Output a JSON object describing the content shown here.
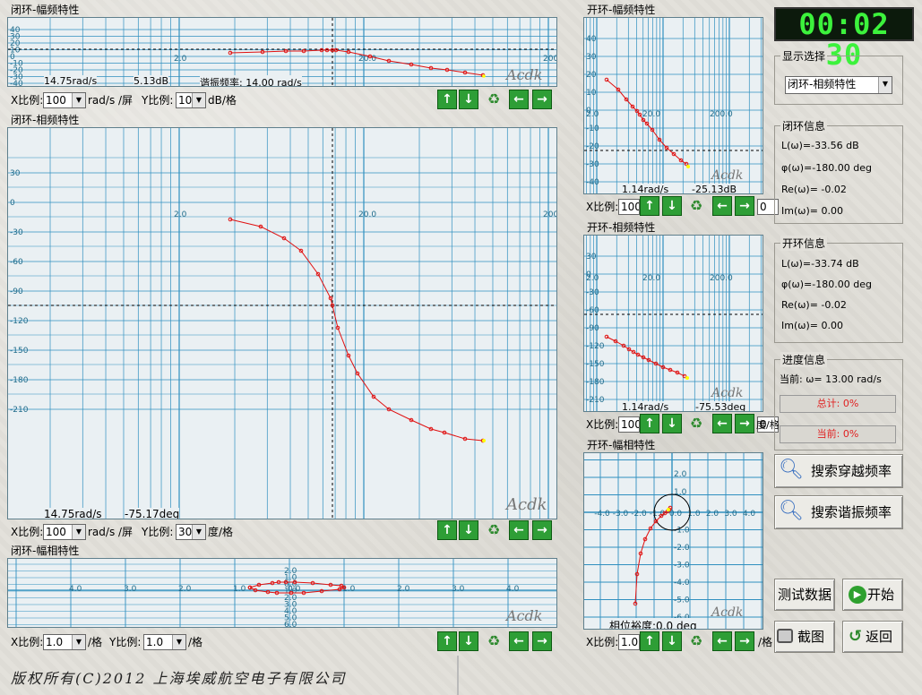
{
  "clock": "00:02 30",
  "brand": "Acdk",
  "footer": "版权所有(C)2012 上海埃威航空电子有限公司",
  "scale": {
    "x_label": "X比例:",
    "y_label": "Y比例:",
    "rad_screen": "rad/s /屏",
    "db_div": "dB/格",
    "deg_div": "度/格",
    "div": "/格",
    "x100": "100",
    "y10": "10",
    "y30": "30",
    "x1": "1.0",
    "y1": "1.0",
    "y0": "0"
  },
  "p1": {
    "title": "闭环-幅频特性",
    "yticks": [
      "40",
      "30",
      "20",
      "10",
      "0",
      "-10",
      "-20",
      "-30",
      "-40"
    ],
    "xticks": [
      "2.0",
      "20.0",
      "200"
    ],
    "readout_w": "14.75rad/s",
    "readout_v": "5.13dB",
    "resonance": "谐振频率: 14.00 rad/s"
  },
  "p2": {
    "title": "闭环-相频特性",
    "yticks": [
      "30",
      "0",
      "-30",
      "-60",
      "-90",
      "-120",
      "-150",
      "-180",
      "-210"
    ],
    "xticks": [
      "2.0",
      "20.0",
      "200"
    ],
    "readout_w": "14.75rad/s",
    "readout_v": "-75.17deg"
  },
  "p3": {
    "title": "闭环-幅相特性",
    "xticks": [
      "4.0",
      "3.0",
      "2.0",
      "1.0",
      "0.0",
      "1.0",
      "2.0",
      "3.0",
      "4.0"
    ],
    "yticks": [
      "2.0",
      "1.0",
      "0.0",
      "1.0",
      "2.0",
      "3.0",
      "4.0",
      "5.0",
      "6.0"
    ]
  },
  "p4": {
    "title": "开环-幅频特性",
    "yticks": [
      "40",
      "30",
      "20",
      "10",
      "0",
      "-10",
      "-20",
      "-30",
      "-40"
    ],
    "xticks": [
      "2.0",
      "20.0",
      "200.0"
    ],
    "readout_w": "1.14rad/s",
    "readout_v": "-25.13dB"
  },
  "p5": {
    "title": "开环-相频特性",
    "yticks": [
      "30",
      "0",
      "-30",
      "-60",
      "-90",
      "-120",
      "-150",
      "-180",
      "-210"
    ],
    "xticks": [
      "2.0",
      "20.0",
      "200.0"
    ],
    "readout_w": "1.14rad/s",
    "readout_v": "-75.53deg",
    "y_div": "度/格"
  },
  "p6": {
    "title": "开环-幅相特性",
    "xticks": [
      "-4.0",
      "-3.0",
      "-2.0",
      "-1.0",
      "0.0",
      "1.0",
      "2.0",
      "3.0",
      "4.0"
    ],
    "yticks": [
      "2.0",
      "1.0",
      "-1.0",
      "-2.0",
      "-3.0",
      "-4.0",
      "-5.0",
      "-6.0"
    ],
    "margin": "相位裕度:0.0 deg"
  },
  "display": {
    "title": "显示选择",
    "value": "闭环-相频特性"
  },
  "closed": {
    "title": "闭环信息",
    "L": "L(ω)=-33.56 dB",
    "phi": "φ(ω)=-180.00 deg",
    "re": "Re(ω)= -0.02",
    "im": "Im(ω)=  0.00"
  },
  "open": {
    "title": "开环信息",
    "L": "L(ω)=-33.74 dB",
    "phi": "φ(ω)=-180.00 deg",
    "re": "Re(ω)= -0.02",
    "im": "Im(ω)=  0.00"
  },
  "progress": {
    "title": "进度信息",
    "current": "当前: ω= 13.00 rad/s",
    "total": "总计: 0%",
    "cur": "当前: 0%"
  },
  "buttons": {
    "search_cross": "搜索穿越频率",
    "search_res": "搜索谐振频率",
    "test": "测试数据",
    "start": "开始",
    "capture": "截图",
    "back": "返回"
  }
}
